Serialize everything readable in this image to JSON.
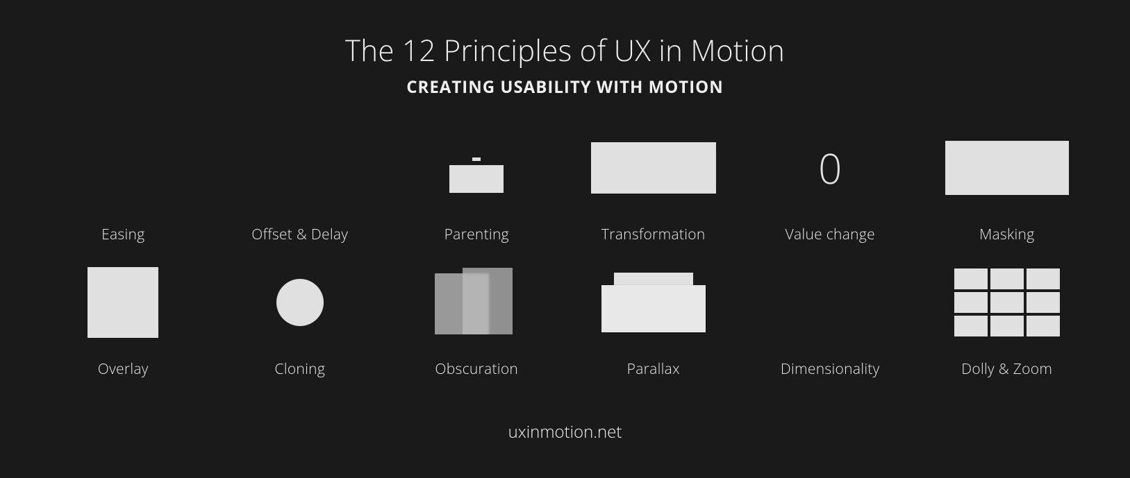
{
  "header": {
    "title": "The 12 Principles of UX in Motion",
    "subtitle": "CREATING USABILITY WITH MOTION"
  },
  "principles": [
    {
      "label": "Easing"
    },
    {
      "label": "Offset & Delay"
    },
    {
      "label": "Parenting"
    },
    {
      "label": "Transformation"
    },
    {
      "label": "Value change",
      "value": "0"
    },
    {
      "label": "Masking"
    },
    {
      "label": "Overlay"
    },
    {
      "label": "Cloning"
    },
    {
      "label": "Obscuration"
    },
    {
      "label": "Parallax"
    },
    {
      "label": "Dimensionality"
    },
    {
      "label": "Dolly & Zoom"
    }
  ],
  "footer": {
    "url": "uxinmotion.net"
  }
}
